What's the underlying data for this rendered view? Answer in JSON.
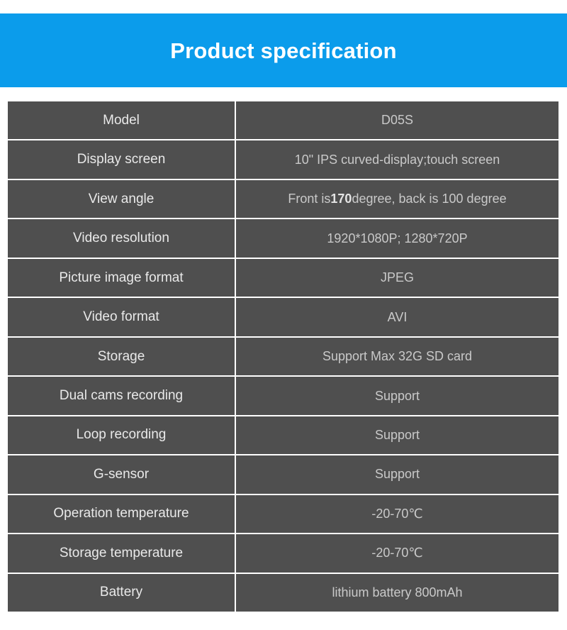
{
  "header": {
    "title": "Product specification",
    "background_color": "#0b9ceb",
    "text_color": "#ffffff"
  },
  "table": {
    "cell_background": "#4f4f4f",
    "label_text_color": "#e9e9e9",
    "value_text_color": "#c9c9c9",
    "separator_color": "#ffffff",
    "columns": 2,
    "rows": [
      {
        "label": "Model",
        "value": "D05S"
      },
      {
        "label": "Display screen",
        "value": "10\" IPS curved-display;touch screen"
      },
      {
        "label": "View angle",
        "value_prefix": "Front is ",
        "value_highlight": "170",
        "value_suffix": " degree, back is 100 degree",
        "value": "Front is 170 degree, back is 100 degree"
      },
      {
        "label": "Video resolution",
        "value": "1920*1080P; 1280*720P"
      },
      {
        "label": "Picture image format",
        "value": "JPEG"
      },
      {
        "label": "Video format",
        "value": "AVI"
      },
      {
        "label": "Storage",
        "value": "Support Max 32G SD card"
      },
      {
        "label": "Dual cams recording",
        "value": "Support"
      },
      {
        "label": "Loop recording",
        "value": "Support"
      },
      {
        "label": "G-sensor",
        "value": "Support"
      },
      {
        "label": "Operation temperature",
        "value": "-20-70℃"
      },
      {
        "label": "Storage temperature",
        "value": "-20-70℃"
      },
      {
        "label": "Battery",
        "value": "lithium battery 800mAh"
      }
    ]
  }
}
